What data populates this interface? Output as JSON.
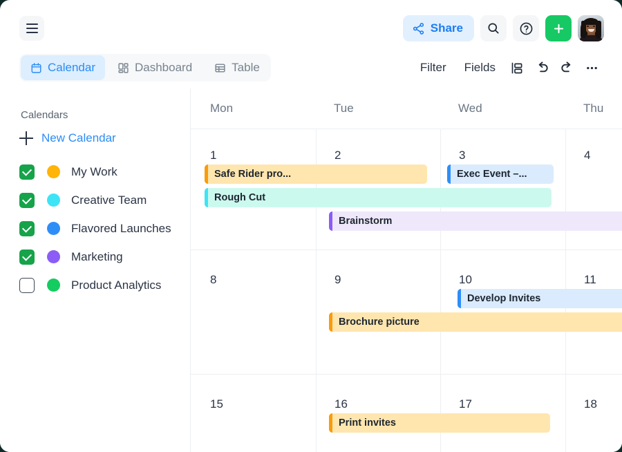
{
  "window": {
    "outside_bg": "#0f2b28",
    "surface_bg": "#ffffff"
  },
  "topbar": {
    "menu_icon": "hamburger-icon",
    "share_label": "Share",
    "share_icon": "share-nodes-icon",
    "search_icon": "search-icon",
    "help_icon": "question-circle-icon",
    "add_icon": "plus-icon",
    "avatar_alt": "user-avatar-photo",
    "accent_blue": "#1c7ef3",
    "add_green": "#17c964"
  },
  "tabs": [
    {
      "label": "Calendar",
      "icon": "calendar-icon",
      "active": true
    },
    {
      "label": "Dashboard",
      "icon": "dashboard-grid-icon",
      "active": false
    },
    {
      "label": "Table",
      "icon": "table-icon",
      "active": false
    }
  ],
  "toolbar": {
    "filter_label": "Filter",
    "fields_label": "Fields",
    "group_icon": "group-rows-icon",
    "undo_icon": "undo-arrow-icon",
    "redo_icon": "redo-arrow-icon",
    "more_icon": "ellipsis-icon"
  },
  "sidebar": {
    "heading": "Calendars",
    "new_calendar_label": "New Calendar",
    "new_calendar_icon": "plus-icon",
    "items": [
      {
        "label": "My Work",
        "checked": true,
        "color": "#ffb40a"
      },
      {
        "label": "Creative Team",
        "checked": true,
        "color": "#3de4f5"
      },
      {
        "label": "Flavored Launches",
        "checked": true,
        "color": "#2e8ef7"
      },
      {
        "label": "Marketing",
        "checked": true,
        "color": "#8b5cf6"
      },
      {
        "label": "Product Analytics",
        "checked": false,
        "color": "#14cc60"
      }
    ]
  },
  "calendar": {
    "daynames": [
      "Mon",
      "Tue",
      "Wed",
      "Thu"
    ],
    "weeks": [
      {
        "days": [
          "1",
          "2",
          "3",
          "4"
        ]
      },
      {
        "days": [
          "8",
          "9",
          "10",
          "11"
        ]
      },
      {
        "days": [
          "15",
          "16",
          "17",
          "18"
        ]
      }
    ],
    "events": [
      {
        "title": "Safe Rider pro...",
        "calendar": "My Work",
        "stripe_color": "#f99b0c",
        "fill_color": "#ffe6ae",
        "week": 1,
        "start_day": "Mon",
        "end_day": "Tue",
        "lane": 1
      },
      {
        "title": "Exec Event –...",
        "calendar": "Flavored Launches",
        "stripe_color": "#2e8ef7",
        "fill_color": "#daebfd",
        "week": 1,
        "start_day": "Wed",
        "end_day": "Wed",
        "lane": 1
      },
      {
        "title": "Rough Cut",
        "calendar": "Creative Team",
        "stripe_color": "#3de4f5",
        "fill_color": "#ccf9ee",
        "week": 1,
        "start_day": "Mon",
        "end_day": "Wed",
        "lane": 2
      },
      {
        "title": "Brainstorm",
        "calendar": "Marketing",
        "stripe_color": "#8b5cf6",
        "fill_color": "#efe8fb",
        "week": 1,
        "start_day": "Tue",
        "end_day": "Thu",
        "lane": 3
      },
      {
        "title": "Develop Invites",
        "calendar": "Flavored Launches",
        "stripe_color": "#2e8ef7",
        "fill_color": "#daebfd",
        "week": 2,
        "start_day": "Wed",
        "end_day": "Thu",
        "lane": 1
      },
      {
        "title": "Brochure picture",
        "calendar": "My Work",
        "stripe_color": "#f99b0c",
        "fill_color": "#ffe6ae",
        "week": 2,
        "start_day": "Tue",
        "end_day": "Thu",
        "lane": 2
      },
      {
        "title": "Print invites",
        "calendar": "My Work",
        "stripe_color": "#f99b0c",
        "fill_color": "#ffe6ae",
        "week": 3,
        "start_day": "Tue",
        "end_day": "Wed",
        "lane": 1
      }
    ]
  }
}
